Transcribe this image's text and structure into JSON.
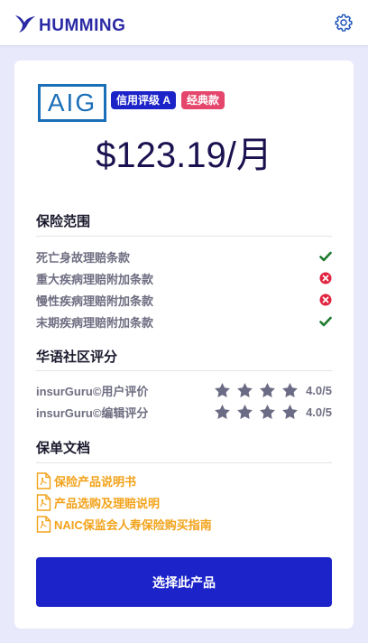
{
  "header": {
    "brand": "HUMMING"
  },
  "product": {
    "insurer": "AIG",
    "badges": [
      "信用评级 A",
      "经典款"
    ],
    "price": "$123.19/月"
  },
  "coverage": {
    "title": "保险范围",
    "items": [
      {
        "label": "死亡身故理赔条款",
        "included": true
      },
      {
        "label": "重大疾病理赔附加条款",
        "included": false
      },
      {
        "label": "慢性疾病理赔附加条款",
        "included": false
      },
      {
        "label": "末期疾病理赔附加条款",
        "included": true
      }
    ]
  },
  "ratings": {
    "title": "华语社区评分",
    "items": [
      {
        "label": "insurGuru©用户评价",
        "score": "4.0/5",
        "stars": 4
      },
      {
        "label": "insurGuru©编辑评分",
        "score": "4.0/5",
        "stars": 4
      }
    ]
  },
  "documents": {
    "title": "保单文档",
    "items": [
      "保险产品说明书",
      "产品选购及理赔说明",
      "NAIC保监会人寿保险购买指南"
    ]
  },
  "cta": "选择此产品",
  "colors": {
    "accent": "#1c24c9",
    "badge_red": "#e5466b",
    "link": "#f2a31b",
    "check": "#1e7a2e",
    "cross": "#e0243f"
  }
}
